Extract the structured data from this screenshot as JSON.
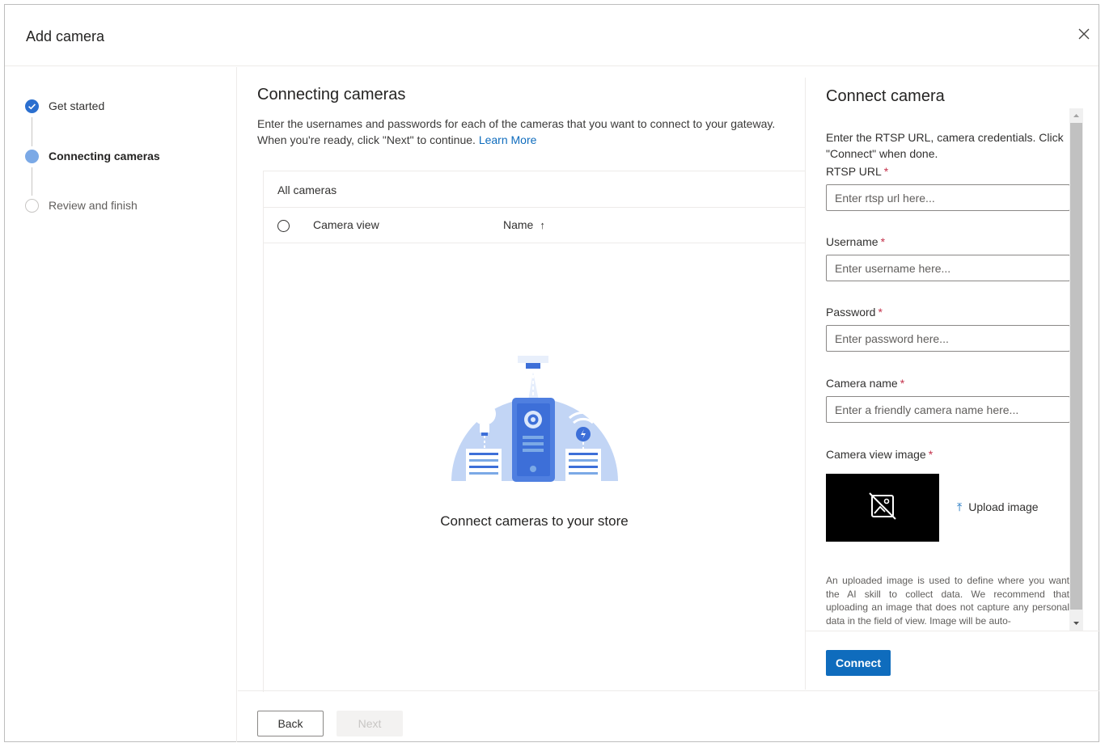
{
  "dialog": {
    "title": "Add camera",
    "close_icon": "close-icon"
  },
  "stepper": {
    "steps": [
      {
        "label": "Get started",
        "state": "completed",
        "icon": "check-circle-icon"
      },
      {
        "label": "Connecting cameras",
        "state": "current",
        "icon": "filled-circle-icon"
      },
      {
        "label": "Review and finish",
        "state": "upcoming",
        "icon": "empty-circle-icon"
      }
    ]
  },
  "main": {
    "title": "Connecting cameras",
    "description": "Enter the usernames and passwords for each of the cameras that you want to connect to your gateway. When you're ready, click \"Next\" to continue.",
    "learn_more": "Learn More",
    "table": {
      "caption": "All cameras",
      "columns": [
        {
          "label": "Camera view"
        },
        {
          "label": "Name",
          "sort": "ascending",
          "sort_icon": "arrow-up-icon"
        }
      ],
      "rows": []
    },
    "empty_state": {
      "illustration": "camera-store-illustration",
      "text": "Connect cameras to your store"
    }
  },
  "footer": {
    "back_label": "Back",
    "next_label": "Next"
  },
  "panel": {
    "title": "Connect camera",
    "description": "Enter the RTSP URL, camera credentials. Click \"Connect\" when done.",
    "fields": {
      "rtsp": {
        "label": "RTSP URL",
        "placeholder": "Enter rtsp url here...",
        "value": ""
      },
      "username": {
        "label": "Username",
        "placeholder": "Enter username here...",
        "value": ""
      },
      "password": {
        "label": "Password",
        "placeholder": "Enter password here...",
        "value": ""
      },
      "camera_name": {
        "label": "Camera name",
        "placeholder": "Enter a friendly camera name here...",
        "value": ""
      }
    },
    "required_marker": "*",
    "camera_view_image": {
      "label": "Camera view image",
      "placeholder_icon": "no-image-icon",
      "upload_label": "Upload image",
      "upload_icon": "upload-arrow-icon"
    },
    "help_text": "An uploaded image is used to define where you want the AI skill to collect data. We recommend that uploading an image that does not capture any personal data in the field of view. Image will be auto-",
    "connect_label": "Connect"
  },
  "colors": {
    "accent": "#0f6cbd",
    "step_completed": "#2b6fcf",
    "step_current": "#7ba9e6",
    "required": "#c4314b",
    "illustration_light": "#c2d5f5",
    "illustration_dark": "#3d6fd8"
  }
}
